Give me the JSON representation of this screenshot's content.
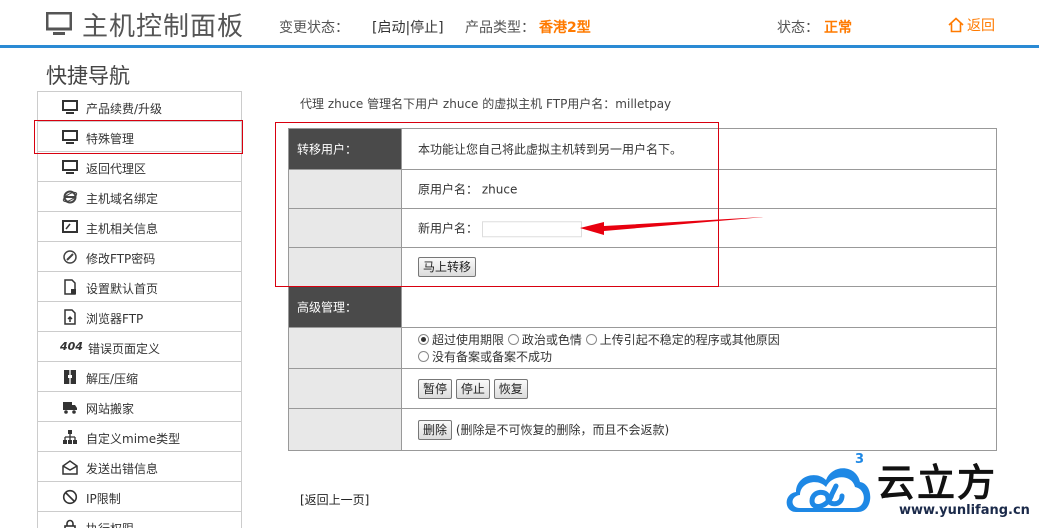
{
  "header": {
    "title": "主机控制面板",
    "change_status_label": "变更状态：",
    "change_status_links": "[启动|停止]",
    "product_type_label": "产品类型：",
    "product_type_value": "香港2型",
    "status_label": "状态：",
    "status_value": "正常",
    "back_label": "返回"
  },
  "quick_nav_title": "快捷导航",
  "sidebar": {
    "items": [
      {
        "label": "产品续费/升级",
        "icon": "monitor-icon"
      },
      {
        "label": "特殊管理",
        "icon": "monitor-icon"
      },
      {
        "label": "返回代理区",
        "icon": "monitor-icon"
      },
      {
        "label": "主机域名绑定",
        "icon": "ie-icon"
      },
      {
        "label": "主机相关信息",
        "icon": "screen-icon"
      },
      {
        "label": "修改FTP密码",
        "icon": "pen-icon"
      },
      {
        "label": "设置默认首页",
        "icon": "page-icon"
      },
      {
        "label": "浏览器FTP",
        "icon": "page-arrow-icon"
      },
      {
        "label": "错误页面定义",
        "icon": "404-icon",
        "icon_text": "404"
      },
      {
        "label": "解压/压缩",
        "icon": "archive-icon"
      },
      {
        "label": "网站搬家",
        "icon": "truck-icon"
      },
      {
        "label": "自定义mime类型",
        "icon": "tree-icon"
      },
      {
        "label": "发送出错信息",
        "icon": "mail-icon"
      },
      {
        "label": "IP限制",
        "icon": "block-icon"
      },
      {
        "label": "执行权限",
        "icon": "lock-icon"
      }
    ]
  },
  "breadcrumb": "代理 zhuce 管理名下用户 zhuce 的虚拟主机 FTP用户名：milletpay",
  "transfer": {
    "section_label": "转移用户：",
    "description": "本功能让您自己将此虚拟主机转到另一用户名下。",
    "original_user_label": "原用户名：",
    "original_user_value": "zhuce",
    "new_user_label": "新用户名：",
    "new_user_value": "",
    "submit_label": "马上转移"
  },
  "advanced": {
    "section_label": "高级管理：",
    "reasons": [
      {
        "label": "超过使用期限",
        "checked": true
      },
      {
        "label": "政治或色情",
        "checked": false
      },
      {
        "label": "上传引起不稳定的程序或其他原因",
        "checked": false
      },
      {
        "label": "没有备案或备案不成功",
        "checked": false
      }
    ],
    "pause_label": "暂停",
    "stop_label": "停止",
    "restore_label": "恢复",
    "delete_label": "删除",
    "delete_note": "(删除是不可恢复的删除，而且不会返款)"
  },
  "back_link": "[返回上一页]",
  "logo": {
    "text": "云立方",
    "sup": "3",
    "url": "www.yunlifang.cn"
  },
  "colors": {
    "accent_blue": "#2a8ad4",
    "orange": "#ff7a00",
    "highlight_red": "#d8000f",
    "label_dark": "#4a4a4a"
  }
}
